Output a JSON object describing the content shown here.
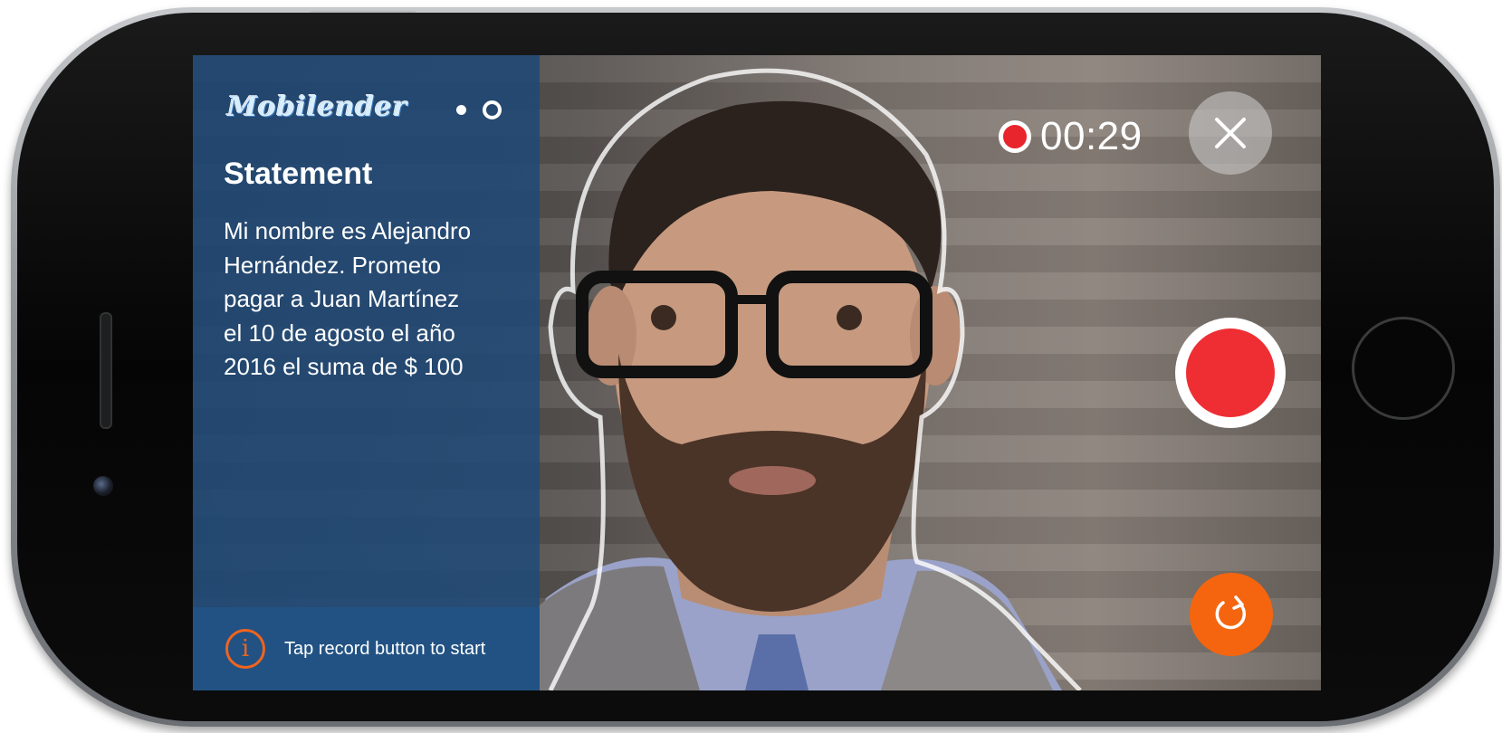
{
  "app": {
    "logo_text": "Mobilender",
    "page_indicator": {
      "total": 2,
      "active_index": 1
    }
  },
  "statement": {
    "title": "Statement",
    "lines": [
      "Mi nombre es Alejandro",
      "Hernández. Prometo",
      "pagar a Juan Martínez",
      "el 10 de agosto el año",
      "2016 el suma de $ 100"
    ]
  },
  "hint": {
    "icon": "info-icon",
    "text": "Tap record button to start"
  },
  "recording": {
    "indicator_icon": "record-dot-icon",
    "timer": "00:29"
  },
  "controls": {
    "close_icon": "close-icon",
    "record_icon": "record-icon",
    "retake_icon": "refresh-icon"
  },
  "colors": {
    "panel_blue": "#1f4876",
    "record_red": "#ee2e33",
    "accent_orange": "#f5650f",
    "info_orange": "#f0641e"
  }
}
